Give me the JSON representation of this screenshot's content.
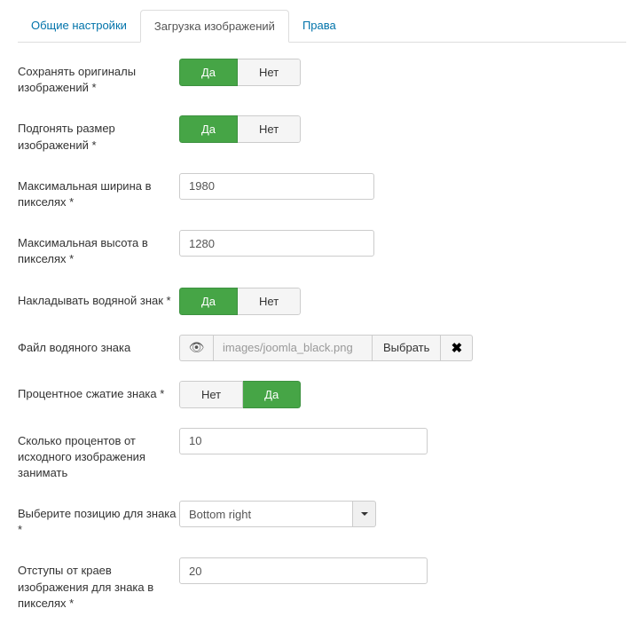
{
  "tabs": {
    "general": "Общие настройки",
    "upload": "Загрузка изображений",
    "rights": "Права"
  },
  "labels": {
    "save_originals": "Сохранять оригиналы изображений *",
    "fit_size": "Подгонять размер изображений *",
    "max_width": "Максимальная ширина в пикселях *",
    "max_height": "Максимальная высота в пикселях *",
    "watermark": "Накладывать водяной знак *",
    "watermark_file": "Файл водяного знака",
    "percent_compress": "Процентное сжатие знака *",
    "percent_of_source": "Сколько процентов от исходного изображения занимать",
    "position": "Выберите позицию для знака *",
    "padding": "Отступы от краев изображения для знака в пикселях *"
  },
  "options": {
    "yes": "Да",
    "no": "Нет"
  },
  "values": {
    "max_width": "1980",
    "max_height": "1280",
    "watermark_file": "images/joomla_black.png",
    "select_btn": "Выбрать",
    "percent": "10",
    "position": "Bottom right",
    "padding": "20"
  }
}
